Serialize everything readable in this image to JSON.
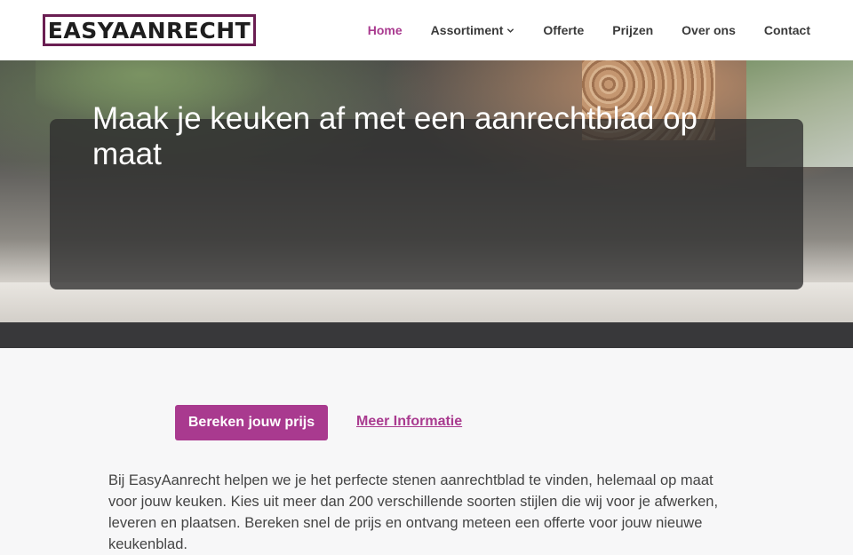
{
  "header": {
    "logo_text": "EASYAANRECHT",
    "nav": [
      {
        "label": "Home",
        "active": true
      },
      {
        "label": "Assortiment",
        "has_dropdown": true
      },
      {
        "label": "Offerte"
      },
      {
        "label": "Prijzen"
      },
      {
        "label": "Over ons"
      },
      {
        "label": "Contact"
      }
    ]
  },
  "hero": {
    "title": "Maak je keuken af met een aanrechtblad op maat"
  },
  "main": {
    "cta_label": "Bereken jouw prijs",
    "info_link_label": "Meer Informatie",
    "intro_text": "Bij EasyAanrecht helpen we je het perfecte stenen aanrechtblad te vinden, helemaal op maat voor jouw keuken. Kies uit meer dan 200 verschillende soorten stijlen die wij voor je afwerken, leveren en plaatsen. Bereken snel de prijs en ontvang meteen een offerte voor jouw nieuwe keukenblad."
  },
  "colors": {
    "accent": "#a93a8f",
    "logo_border": "#6a1e52",
    "nav_text": "#3a3a3a"
  },
  "icons": {
    "dropdown": "chevron-down-icon"
  }
}
